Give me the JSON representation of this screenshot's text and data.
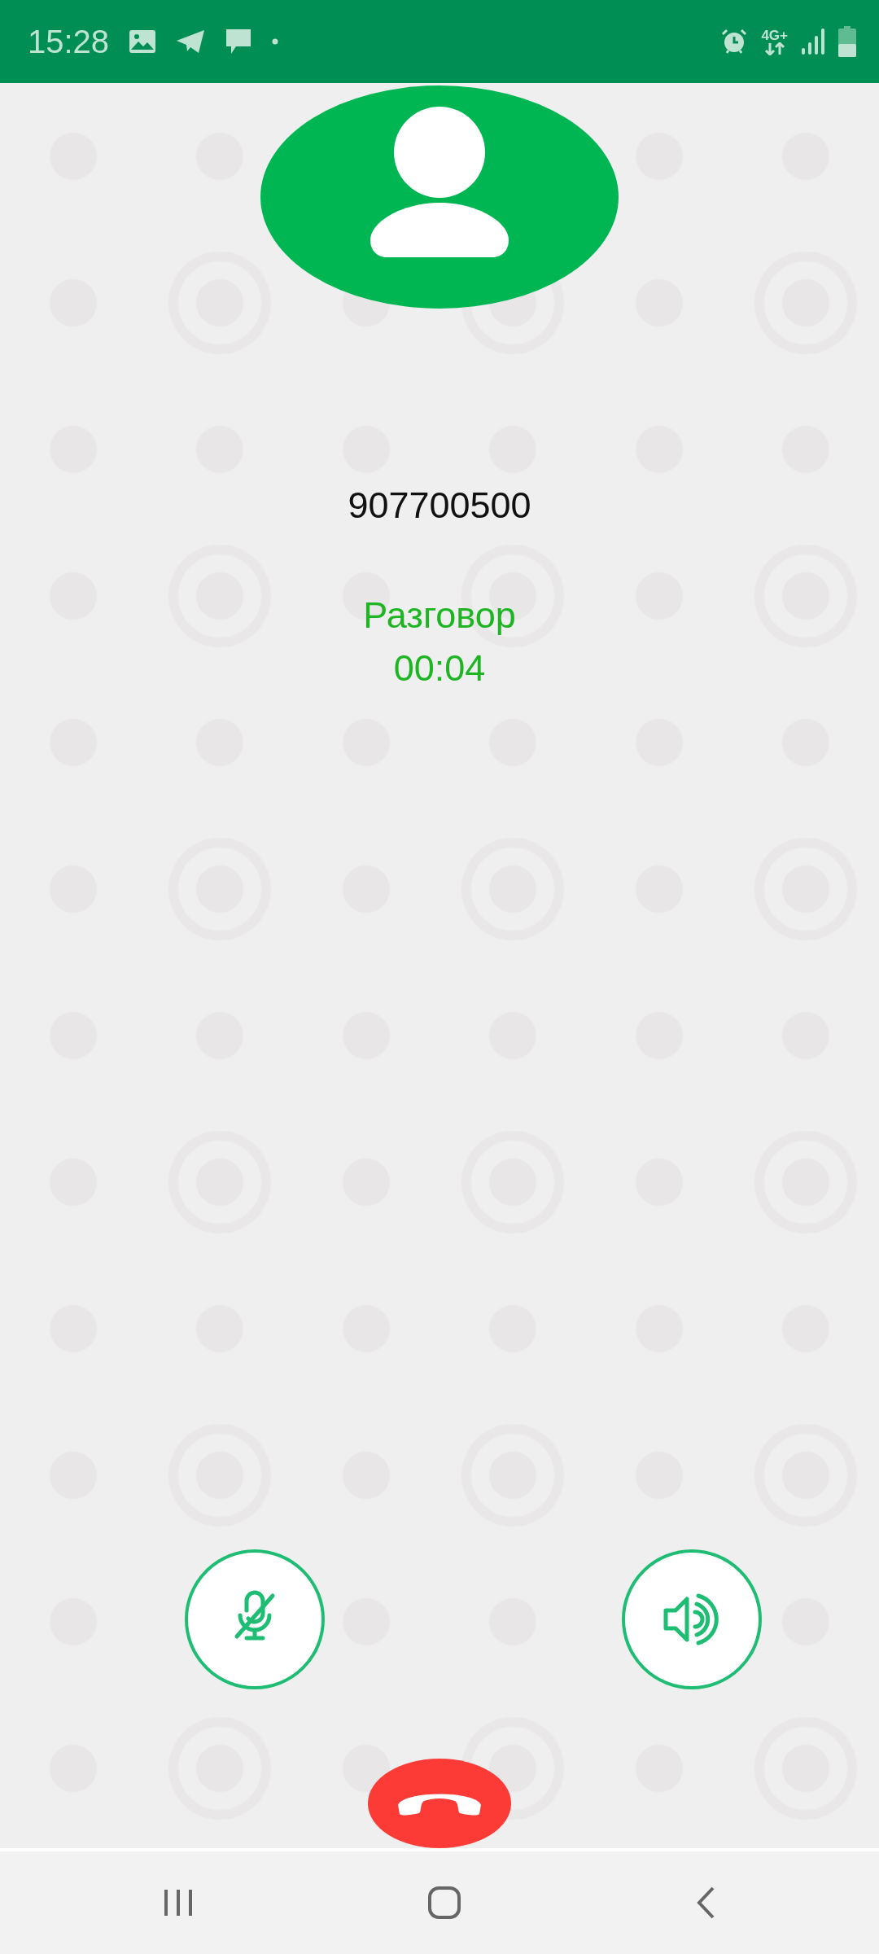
{
  "status_bar": {
    "time": "15:28",
    "network": "4G+"
  },
  "contact": {
    "number": "907700500",
    "call_state": "Разговор",
    "duration": "00:04"
  },
  "controls": [
    {
      "kind": "mute"
    },
    {
      "kind": "speaker"
    }
  ]
}
